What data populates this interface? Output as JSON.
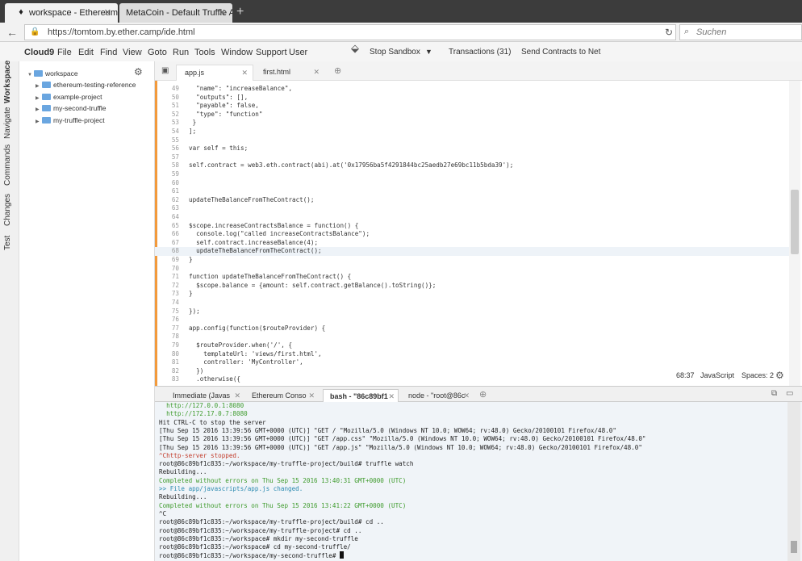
{
  "browser": {
    "tabs": [
      {
        "label": "workspace - Ethereum Stu..."
      },
      {
        "label": "MetaCoin - Default Truffle App"
      }
    ],
    "url": "https://tomtom.by.ether.camp/ide.html",
    "search_placeholder": "Suchen"
  },
  "menubar": {
    "logo": "Cloud9",
    "items": [
      "File",
      "Edit",
      "Find",
      "View",
      "Goto",
      "Run",
      "Tools",
      "Window",
      "Support",
      "User"
    ],
    "stop_sandbox": "Stop Sandbox",
    "transactions": "Transactions (31)",
    "send_contracts": "Send Contracts to Net"
  },
  "side_panels": [
    "Workspace",
    "Navigate",
    "Commands",
    "Changes",
    "Test"
  ],
  "tree": {
    "root": "workspace",
    "items": [
      "ethereum-testing-reference",
      "example-project",
      "my-second-truffle",
      "my-truffle-project"
    ]
  },
  "editor_tabs": [
    {
      "label": "app.js"
    },
    {
      "label": "first.html"
    }
  ],
  "editor": {
    "lines": [
      {
        "n": "49",
        "code": "  \"name\": \"increaseBalance\","
      },
      {
        "n": "50",
        "code": "  \"outputs\": [],"
      },
      {
        "n": "51",
        "code": "  \"payable\": false,"
      },
      {
        "n": "52",
        "code": "  \"type\": \"function\""
      },
      {
        "n": "53",
        "code": " }"
      },
      {
        "n": "54",
        "code": "];"
      },
      {
        "n": "55",
        "code": ""
      },
      {
        "n": "56",
        "code": "var self = this;"
      },
      {
        "n": "57",
        "code": ""
      },
      {
        "n": "58",
        "code": "self.contract = web3.eth.contract(abi).at('0x17956ba5f4291844bc25aedb27e69bc11b5bda39');"
      },
      {
        "n": "59",
        "code": ""
      },
      {
        "n": "60",
        "code": ""
      },
      {
        "n": "61",
        "code": ""
      },
      {
        "n": "62",
        "code": "updateTheBalanceFromTheContract();"
      },
      {
        "n": "63",
        "code": ""
      },
      {
        "n": "64",
        "code": ""
      },
      {
        "n": "65",
        "code": "$scope.increaseContractsBalance = function() {"
      },
      {
        "n": "66",
        "code": "  console.log(\"called increaseContractsBalance\");"
      },
      {
        "n": "67",
        "code": "  self.contract.increaseBalance(4);"
      },
      {
        "n": "68",
        "code": "  updateTheBalanceFromTheContract();"
      },
      {
        "n": "69",
        "code": "}"
      },
      {
        "n": "70",
        "code": ""
      },
      {
        "n": "71",
        "code": "function updateTheBalanceFromTheContract() {"
      },
      {
        "n": "72",
        "code": "  $scope.balance = {amount: self.contract.getBalance().toString()};"
      },
      {
        "n": "73",
        "code": "}"
      },
      {
        "n": "74",
        "code": ""
      },
      {
        "n": "75",
        "code": "});"
      },
      {
        "n": "76",
        "code": ""
      },
      {
        "n": "77",
        "code": "app.config(function($routeProvider) {"
      },
      {
        "n": "78",
        "code": ""
      },
      {
        "n": "79",
        "code": "  $routeProvider.when('/', {"
      },
      {
        "n": "80",
        "code": "    templateUrl: 'views/first.html',"
      },
      {
        "n": "81",
        "code": "    controller: 'MyController',"
      },
      {
        "n": "82",
        "code": "  })"
      },
      {
        "n": "83",
        "code": "  .otherwise({"
      }
    ],
    "highlighted_line": "68",
    "cursor_pos": "68:37",
    "language": "JavaScript",
    "spaces": "Spaces: 2"
  },
  "terminal_tabs": [
    {
      "label": "Immediate (Javas"
    },
    {
      "label": "Ethereum Conso"
    },
    {
      "label": "bash - \"86c89bf1"
    },
    {
      "label": "node - \"root@86c"
    }
  ],
  "terminal": {
    "lines": [
      {
        "text": "  http://127.0.0.1:8080",
        "style": "green"
      },
      {
        "text": "  http://172.17.0.7:8080",
        "style": "green"
      },
      {
        "text": "Hit CTRL-C to stop the server",
        "style": ""
      },
      {
        "text": "[Thu Sep 15 2016 13:39:56 GMT+0000 (UTC)] \"GET / \"Mozilla/5.0 (Windows NT 10.0; WOW64; rv:48.0) Gecko/20100101 Firefox/48.0\"",
        "style": ""
      },
      {
        "text": "[Thu Sep 15 2016 13:39:56 GMT+0000 (UTC)] \"GET /app.css\" \"Mozilla/5.0 (Windows NT 10.0; WOW64; rv:48.0) Gecko/20100101 Firefox/48.0\"",
        "style": ""
      },
      {
        "text": "[Thu Sep 15 2016 13:39:56 GMT+0000 (UTC)] \"GET /app.js\" \"Mozilla/5.0 (Windows NT 10.0; WOW64; rv:48.0) Gecko/20100101 Firefox/48.0\"",
        "style": ""
      },
      {
        "text": "^Chttp-server stopped.",
        "style": "red"
      },
      {
        "text": "root@86c89bf1c835:~/workspace/my-truffle-project/build# truffle watch",
        "style": ""
      },
      {
        "text": "Rebuilding...",
        "style": ""
      },
      {
        "text": "Completed without errors on Thu Sep 15 2016 13:40:31 GMT+0000 (UTC)",
        "style": "green"
      },
      {
        "text": ">> File app/javascripts/app.js changed.",
        "style": "cyan"
      },
      {
        "text": "Rebuilding...",
        "style": ""
      },
      {
        "text": "Completed without errors on Thu Sep 15 2016 13:41:22 GMT+0000 (UTC)",
        "style": "green"
      },
      {
        "text": "^C",
        "style": ""
      },
      {
        "text": "root@86c89bf1c835:~/workspace/my-truffle-project/build# cd ..",
        "style": ""
      },
      {
        "text": "root@86c89bf1c835:~/workspace/my-truffle-project# cd ..",
        "style": ""
      },
      {
        "text": "root@86c89bf1c835:~/workspace# mkdir my-second-truffle",
        "style": ""
      },
      {
        "text": "root@86c89bf1c835:~/workspace# cd my-second-truffle/",
        "style": ""
      },
      {
        "text": "root@86c89bf1c835:~/workspace/my-second-truffle# ",
        "style": ""
      }
    ]
  }
}
